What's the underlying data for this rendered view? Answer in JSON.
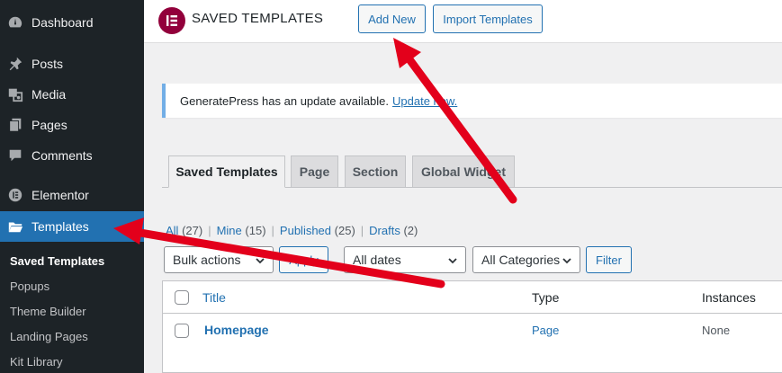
{
  "sidebar": {
    "items": [
      {
        "label": "Dashboard",
        "icon": "dashboard-icon"
      },
      {
        "label": "Posts",
        "icon": "pin-icon"
      },
      {
        "label": "Media",
        "icon": "media-icon"
      },
      {
        "label": "Pages",
        "icon": "pages-icon"
      },
      {
        "label": "Comments",
        "icon": "comments-icon"
      },
      {
        "label": "Elementor",
        "icon": "elementor-icon"
      },
      {
        "label": "Templates",
        "icon": "folder-icon"
      }
    ],
    "subitems": [
      "Saved Templates",
      "Popups",
      "Theme Builder",
      "Landing Pages",
      "Kit Library"
    ]
  },
  "header": {
    "title": "SAVED TEMPLATES",
    "add_new": "Add New",
    "import": "Import Templates"
  },
  "notice": {
    "text": "GeneratePress has an update available.",
    "link": "Update now."
  },
  "tabs": [
    "Saved Templates",
    "Page",
    "Section",
    "Global Widget"
  ],
  "filters": {
    "all": "All",
    "all_count": "(27)",
    "mine": "Mine",
    "mine_count": "(15)",
    "published": "Published",
    "published_count": "(25)",
    "drafts": "Drafts",
    "drafts_count": "(2)",
    "bulk_actions": "Bulk actions",
    "apply": "Apply",
    "dates": "All dates",
    "categories": "All Categories",
    "filter": "Filter"
  },
  "table": {
    "headers": {
      "title": "Title",
      "type": "Type",
      "instances": "Instances"
    },
    "rows": [
      {
        "title": "Homepage",
        "type": "Page",
        "instances": "None"
      }
    ]
  },
  "colors": {
    "sidebar_bg": "#1d2327",
    "accent": "#2271b1",
    "annotation_arrow": "#e3001b",
    "elementor_brand": "#92003b"
  }
}
